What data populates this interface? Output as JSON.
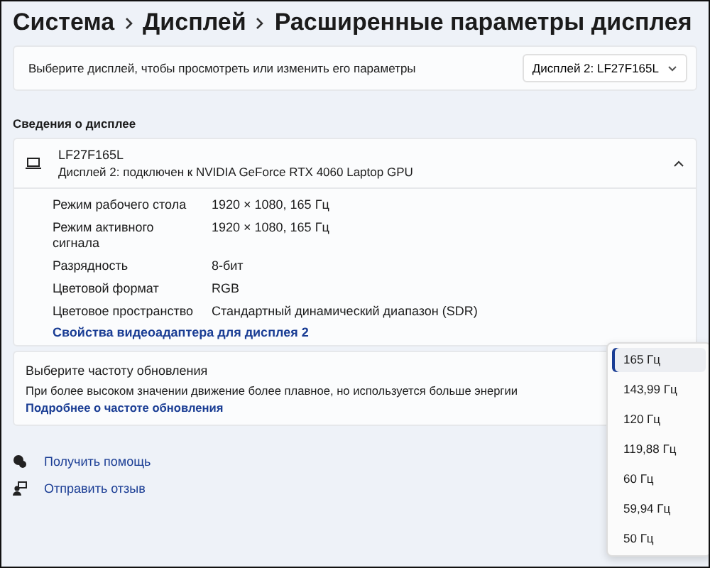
{
  "breadcrumb": [
    "Система",
    "Дисплей",
    "Расширенные параметры дисплея"
  ],
  "display_select": {
    "label": "Выберите дисплей, чтобы просмотреть или изменить его параметры",
    "value": "Дисплей 2: LF27F165L"
  },
  "section_title": "Сведения о дисплее",
  "display_info": {
    "name": "LF27F165L",
    "description": "Дисплей 2: подключен к NVIDIA GeForce RTX 4060 Laptop GPU",
    "expanded": true,
    "rows": [
      {
        "label": "Режим рабочего стола",
        "value": "1920 × 1080, 165 Гц"
      },
      {
        "label": "Режим активного сигнала",
        "value": "1920 × 1080, 165 Гц"
      },
      {
        "label": "Разрядность",
        "value": "8-бит"
      },
      {
        "label": "Цветовой формат",
        "value": "RGB"
      },
      {
        "label": "Цветовое пространство",
        "value": "Стандартный динамический диапазон (SDR)"
      }
    ],
    "link": "Свойства видеоадаптера для дисплея 2"
  },
  "refresh_rate": {
    "title": "Выберите частоту обновления",
    "description": "При более высоком значении движение более плавное, но используется больше энергии",
    "link": "Подробнее о частоте обновления"
  },
  "refresh_menu": [
    {
      "label": "165 Гц",
      "selected": true
    },
    {
      "label": "143,99 Гц",
      "selected": false
    },
    {
      "label": "120 Гц",
      "selected": false
    },
    {
      "label": "119,88 Гц",
      "selected": false
    },
    {
      "label": "60 Гц",
      "selected": false
    },
    {
      "label": "59,94 Гц",
      "selected": false
    },
    {
      "label": "50 Гц",
      "selected": false
    }
  ],
  "footer_links": [
    {
      "kind": "help",
      "label": "Получить помощь"
    },
    {
      "kind": "feedback",
      "label": "Отправить отзыв"
    }
  ]
}
